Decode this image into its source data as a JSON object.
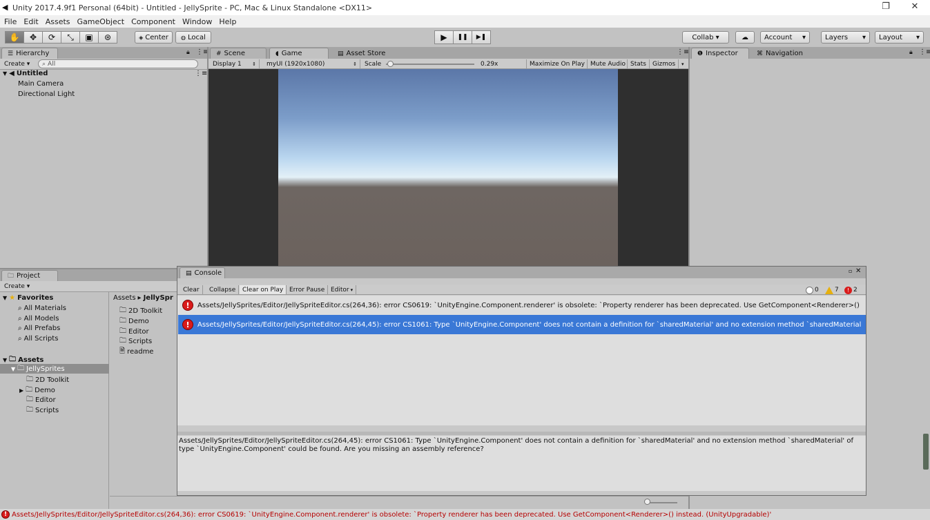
{
  "window": {
    "title": "Unity 2017.4.9f1 Personal (64bit) - Untitled - JellySprite - PC, Mac & Linux Standalone <DX11>",
    "restore_glyph": "❐",
    "close_glyph": "✕"
  },
  "menu": [
    "File",
    "Edit",
    "Assets",
    "GameObject",
    "Component",
    "Window",
    "Help"
  ],
  "toolbar": {
    "tools": [
      "hand-icon",
      "move-icon",
      "rotate-icon",
      "scale-icon",
      "rect-icon",
      "transform-icon"
    ],
    "tool_glyphs": [
      "✋",
      "✥",
      "⟳",
      "⤡",
      "▣",
      "⊛"
    ],
    "pivot": "Center",
    "space": "Local",
    "play_glyph": "▶",
    "pause_glyph": "❚❚",
    "step_glyph": "▶❚",
    "collab": "Collab ▾",
    "cloud_glyph": "☁",
    "account": "Account",
    "layers": "Layers",
    "layout": "Layout",
    "dropdown_glyph": "▾"
  },
  "hierarchy": {
    "tab": "Hierarchy",
    "create": "Create ▾",
    "search_placeholder": "All",
    "scene": "Untitled",
    "items": [
      "Main Camera",
      "Directional Light"
    ]
  },
  "center_tabs": {
    "scene": "Scene",
    "game": "Game",
    "asset_store": "Asset Store"
  },
  "game_bar": {
    "display": "Display 1",
    "resolution": "myUI (1920x1080)",
    "scale_label": "Scale",
    "scale_value": "0.29x",
    "scale_level": 0.05,
    "maximize": "Maximize On Play",
    "mute": "Mute Audio",
    "stats": "Stats",
    "gizmos": "Gizmos"
  },
  "right_tabs": {
    "inspector": "Inspector",
    "navigation": "Navigation"
  },
  "project": {
    "tab": "Project",
    "create": "Create ▾",
    "favorites": "Favorites",
    "favorite_items": [
      "All Materials",
      "All Models",
      "All Prefabs",
      "All Scripts"
    ],
    "assets": "Assets",
    "jelly": "JellySprites",
    "jelly_children": [
      "2D Toolkit",
      "Demo",
      "Editor",
      "Scripts"
    ],
    "breadcrumb_root": "Assets",
    "breadcrumb_sep": "▸",
    "breadcrumb_leaf": "JellySpr",
    "files": [
      "2D Toolkit",
      "Demo",
      "Editor",
      "Scripts",
      "readme"
    ]
  },
  "console": {
    "tab": "Console",
    "buttons": [
      "Clear",
      "Collapse",
      "Clear on Play",
      "Error Pause",
      "Editor"
    ],
    "info_count": "0",
    "warn_count": "7",
    "error_count": "2",
    "entries": [
      "Assets/JellySprites/Editor/JellySpriteEditor.cs(264,36): error CS0619: `UnityEngine.Component.renderer' is obsolete: `Property renderer has been deprecated. Use GetComponent<Renderer>()",
      "Assets/JellySprites/Editor/JellySpriteEditor.cs(264,45): error CS1061: Type `UnityEngine.Component' does not contain a definition for `sharedMaterial' and no extension method `sharedMaterial"
    ],
    "detail": "Assets/JellySprites/Editor/JellySpriteEditor.cs(264,45): error CS1061: Type `UnityEngine.Component' does not contain a definition for `sharedMaterial' and no extension method `sharedMaterial' of type `UnityEngine.Component' could be found. Are you missing an assembly reference?"
  },
  "status": "Assets/JellySprites/Editor/JellySpriteEditor.cs(264,36): error CS0619: `UnityEngine.Component.renderer' is obsolete: `Property renderer has been deprecated. Use GetComponent<Renderer>() instead. (UnityUpgradable)'",
  "colors": {
    "selection": "#3a78d6",
    "error": "#d91b1b",
    "warning": "#e7b00e",
    "editor_bg": "#c2c2c2"
  }
}
